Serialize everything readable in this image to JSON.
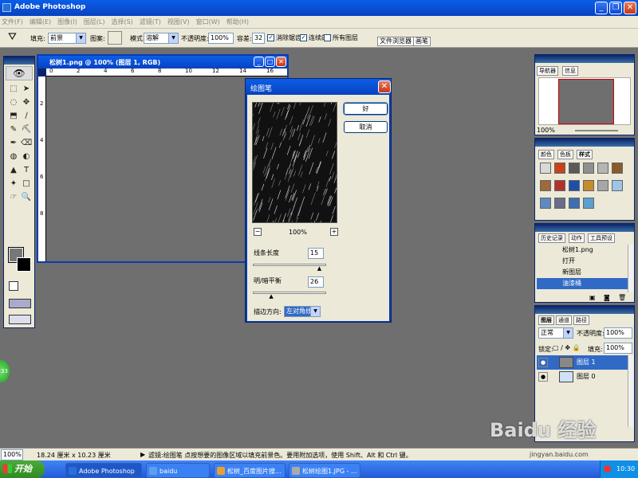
{
  "app": {
    "title": "Adobe Photoshop"
  },
  "menu": [
    "文件(F)",
    "编辑(E)",
    "图像(I)",
    "图层(L)",
    "选择(S)",
    "滤镜(T)",
    "视图(V)",
    "窗口(W)",
    "帮助(H)"
  ],
  "options": {
    "fill_label": "填充:",
    "fill_value": "前景",
    "pattern_label": "图案:",
    "mode_label": "模式:",
    "mode_value": "溶解",
    "opacity_label": "不透明度:",
    "opacity_value": "100%",
    "tolerance_label": "容差:",
    "tolerance_value": "32",
    "antialias_label": "消除锯齿",
    "contiguous_label": "连续的",
    "alllayers_label": "所有图层",
    "tab_browser": "文件浏览器",
    "tab_brushes": "画笔"
  },
  "document": {
    "title": "松树1.png @ 100% (图层 1, RGB)",
    "ruler_labels": [
      "0",
      "2",
      "4",
      "6",
      "8",
      "10",
      "12",
      "14",
      "16",
      "18",
      "20",
      "22"
    ],
    "vruler_labels": [
      "2",
      "4",
      "6",
      "8"
    ]
  },
  "dialog": {
    "title": "绘图笔",
    "ok": "好",
    "cancel": "取消",
    "zoom": "100%",
    "minus": "−",
    "plus": "+",
    "stroke_length_label": "线条长度",
    "stroke_length_value": "15",
    "stroke_length_level": 0.93,
    "balance_label": "明/暗平衡",
    "balance_value": "26",
    "balance_level": 0.26,
    "direction_label": "描边方向:",
    "direction_value": "左对角线"
  },
  "navigator": {
    "tab1": "导航器",
    "tab2": "信息",
    "zoom": "100%",
    "accent": "#cc0000"
  },
  "color_panel": {
    "tab1": "颜色",
    "tab2": "色板",
    "tab3": "样式"
  },
  "styles": [
    "#d9d9d9",
    "#c8421a",
    "#5a5a5a",
    "#8f8f8f",
    "#b5b5b5",
    "#8b5a2b",
    "#9c6a3c",
    "#b2322a",
    "#1f4fa8",
    "#c58c2c",
    "#a7a7a7",
    "#9ec4e8",
    "#5e8ac0",
    "#6b6b8a",
    "#3f6fb0",
    "#5aa0d0"
  ],
  "history": {
    "tab1": "历史记录",
    "tab2": "动作",
    "tab3": "工具预设",
    "items": [
      "松树1.png",
      "打开",
      "新图层",
      "油漆桶"
    ],
    "selected": "油漆桶",
    "highlight": "#316ac5"
  },
  "layers": {
    "tab1": "图层",
    "tab2": "通道",
    "tab3": "路径",
    "blend": "正常",
    "opacity_label": "不透明度:",
    "opacity_value": "100%",
    "lock_label": "锁定:",
    "fill_label": "填充:",
    "fill_value": "100%",
    "rows": [
      "图层 1",
      "图层 0"
    ]
  },
  "status": {
    "zoom": "100%",
    "doc_size": "18.24 厘米 x 10.23 厘米",
    "hint": "滤镜:绘图笔  点按想要的图像区域以填充前景色。要用附加选项，使用 Shift、Alt 和 Ctrl 键。"
  },
  "taskbar": {
    "start": "开始",
    "items": [
      "Adobe Photoshop",
      "baidu",
      "松树_百度图片搜...",
      "松树绘图1.JPG - ..."
    ],
    "clock": "10:30",
    "badge": "33"
  },
  "watermark": {
    "text": "Baidu 经验",
    "url": "jingyan.baidu.com"
  }
}
